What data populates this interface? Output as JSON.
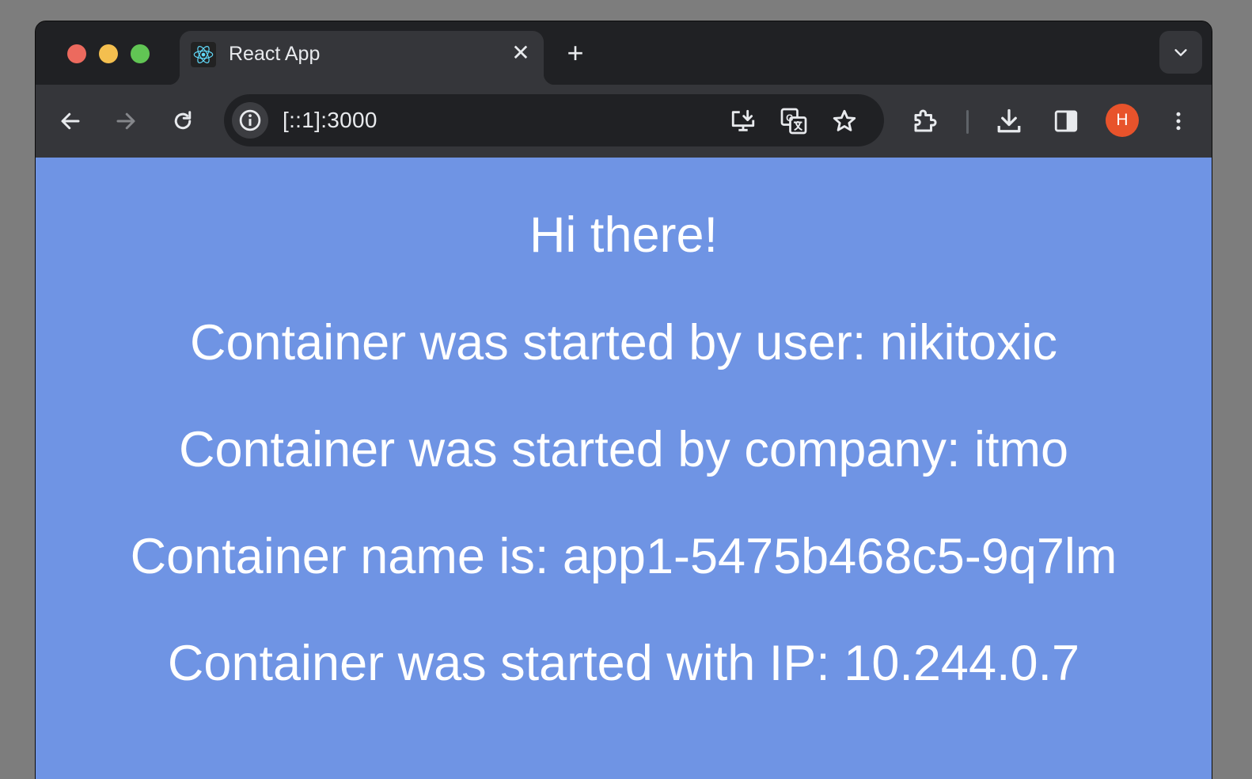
{
  "browser": {
    "tab": {
      "title": "React App",
      "favicon": "react-logo-icon",
      "close_glyph": "✕"
    },
    "new_tab_glyph": "+",
    "omnibox": {
      "url": "[::1]:3000"
    },
    "profile": {
      "initial": "H",
      "color": "#e8532b"
    }
  },
  "page": {
    "background": "#6f94e4",
    "lines": [
      "Hi there!",
      "Container was started by user: nikitoxic",
      "Container was started by company: itmo",
      "Container name is: app1-5475b468c5-9q7lm",
      "Container was started with IP: 10.244.0.7"
    ]
  }
}
